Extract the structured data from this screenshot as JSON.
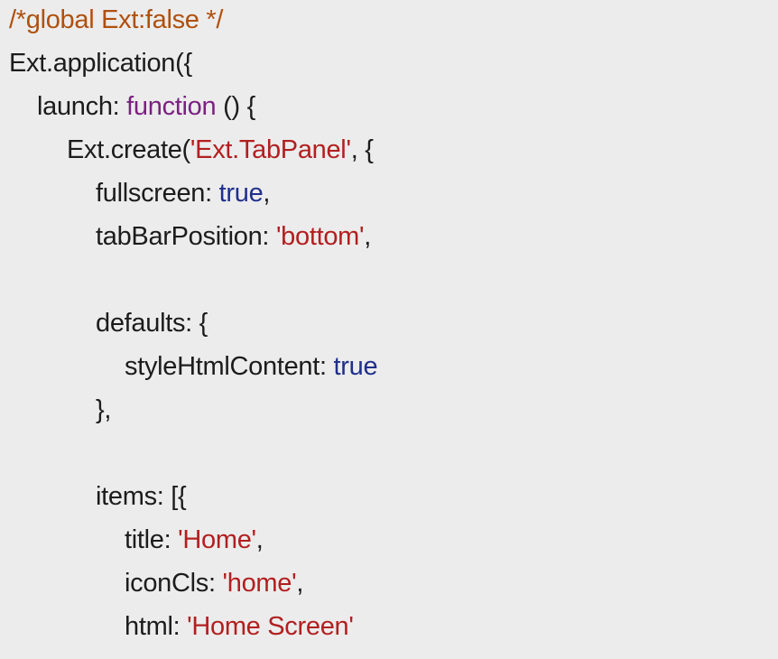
{
  "colors": {
    "background": "#ececec",
    "plain_text": "#1c1c1c",
    "comment": "#b0500e",
    "keyword": "#7b2180",
    "string": "#b21f1f",
    "boolean": "#1f2f8c"
  },
  "code": {
    "line_0": {
      "comment": "/*global Ext:false */"
    },
    "line_1": {
      "text": "Ext.application({"
    },
    "line_2": {
      "key": "launch: ",
      "keyword": "function",
      "rest": " () {"
    },
    "line_3": {
      "pre": "Ext.create(",
      "string": "'Ext.TabPanel'",
      "post": ", {"
    },
    "line_4": {
      "key": "fullscreen: ",
      "value": "true",
      "post": ","
    },
    "line_5": {
      "key": "tabBarPosition: ",
      "value": "'bottom'",
      "post": ","
    },
    "line_6": {
      "text": ""
    },
    "line_7": {
      "text": "defaults: {"
    },
    "line_8": {
      "key": "styleHtmlContent: ",
      "value": "true"
    },
    "line_9": {
      "text": "},"
    },
    "line_10": {
      "text": ""
    },
    "line_11": {
      "text": "items: [{"
    },
    "line_12": {
      "key": "title: ",
      "value": "'Home'",
      "post": ","
    },
    "line_13": {
      "key": "iconCls: ",
      "value": "'home'",
      "post": ","
    },
    "line_14": {
      "key": "html: ",
      "value": "'Home Screen'"
    }
  }
}
